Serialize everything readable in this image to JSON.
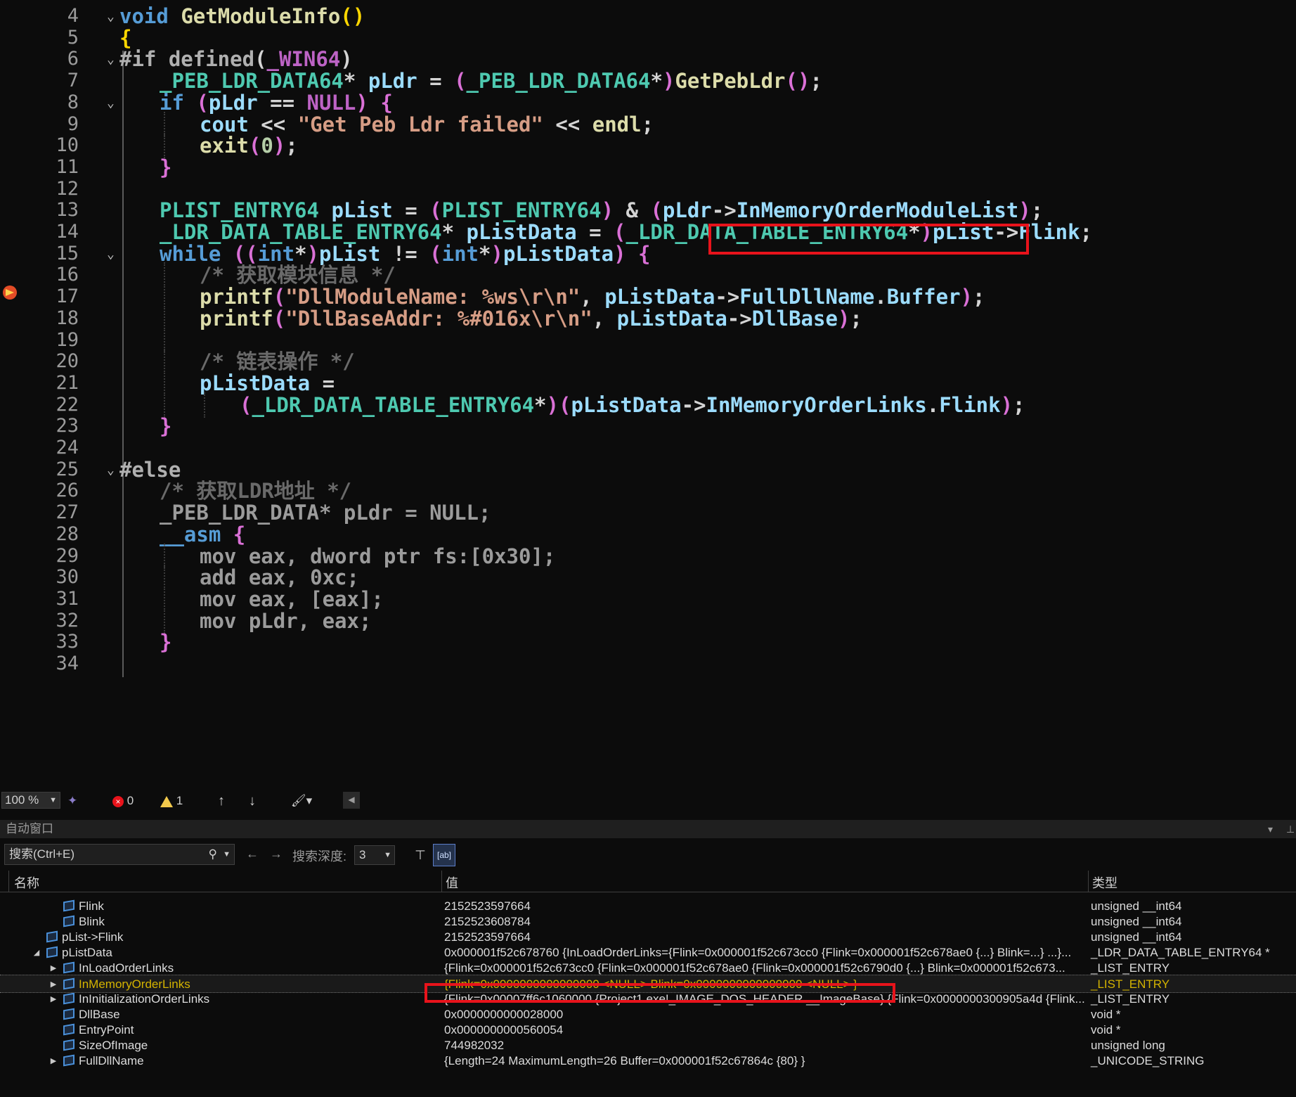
{
  "editor": {
    "lines": [
      {
        "n": "4",
        "i": 0,
        "fold": true,
        "segs": [
          [
            "void ",
            "kw"
          ],
          [
            "GetModuleInfo",
            "fn"
          ],
          [
            "()",
            "br2"
          ]
        ]
      },
      {
        "n": "5",
        "i": 0,
        "segs": [
          [
            "{",
            "br2"
          ]
        ]
      },
      {
        "n": "6",
        "i": 0,
        "fold": true,
        "segs": [
          [
            "#if ",
            "pp"
          ],
          [
            "defined",
            "pp"
          ],
          [
            "(",
            "pu"
          ],
          [
            "_WIN64",
            "mac"
          ],
          [
            ")",
            "pu"
          ]
        ]
      },
      {
        "n": "7",
        "i": 1,
        "segs": [
          [
            "_PEB_LDR_DATA64",
            "ty"
          ],
          [
            "* ",
            "pu"
          ],
          [
            "pLdr",
            "var"
          ],
          [
            " = ",
            "pu"
          ],
          [
            "(",
            "br"
          ],
          [
            "_PEB_LDR_DATA64",
            "ty"
          ],
          [
            "*",
            "pu"
          ],
          [
            ")",
            "br"
          ],
          [
            "GetPebLdr",
            "fn"
          ],
          [
            "()",
            "br"
          ],
          [
            ";",
            "pu"
          ]
        ]
      },
      {
        "n": "8",
        "i": 1,
        "fold": true,
        "segs": [
          [
            "if ",
            "kw"
          ],
          [
            "(",
            "br"
          ],
          [
            "pLdr",
            "var"
          ],
          [
            " == ",
            "pu"
          ],
          [
            "NULL",
            "mac"
          ],
          [
            ")",
            "br"
          ],
          [
            " {",
            "br"
          ]
        ]
      },
      {
        "n": "9",
        "i": 2,
        "segs": [
          [
            "cout",
            "var"
          ],
          [
            " << ",
            "pu"
          ],
          [
            "\"Get Peb Ldr failed\"",
            "st"
          ],
          [
            " << ",
            "pu"
          ],
          [
            "endl",
            "fn"
          ],
          [
            ";",
            "pu"
          ]
        ]
      },
      {
        "n": "10",
        "i": 2,
        "segs": [
          [
            "exit",
            "fn"
          ],
          [
            "(",
            "br"
          ],
          [
            "0",
            "num"
          ],
          [
            ")",
            "br"
          ],
          [
            ";",
            "pu"
          ]
        ]
      },
      {
        "n": "11",
        "i": 1,
        "segs": [
          [
            "}",
            "br"
          ]
        ]
      },
      {
        "n": "12",
        "i": 1,
        "segs": []
      },
      {
        "n": "13",
        "i": 1,
        "segs": [
          [
            "PLIST_ENTRY64",
            "ty"
          ],
          [
            " pList",
            "var"
          ],
          [
            " = ",
            "pu"
          ],
          [
            "(",
            "br"
          ],
          [
            "PLIST_ENTRY64",
            "ty"
          ],
          [
            ")",
            "br"
          ],
          [
            " & ",
            "pu"
          ],
          [
            "(",
            "br"
          ],
          [
            "pLdr",
            "var"
          ],
          [
            "->",
            "pu"
          ],
          [
            "InMemoryOrderModuleList",
            "var"
          ],
          [
            ")",
            "br"
          ],
          [
            ";",
            "pu"
          ]
        ]
      },
      {
        "n": "14",
        "i": 1,
        "segs": [
          [
            "_LDR_DATA_TABLE_ENTRY64",
            "ty"
          ],
          [
            "* ",
            "pu"
          ],
          [
            "pListData",
            "var"
          ],
          [
            " = ",
            "pu"
          ],
          [
            "(",
            "br"
          ],
          [
            "_LDR_DATA_TABLE_ENTRY64",
            "ty"
          ],
          [
            "*",
            "pu"
          ],
          [
            ")",
            "br"
          ],
          [
            "pList",
            "var"
          ],
          [
            "->",
            "pu"
          ],
          [
            "Flink",
            "var"
          ],
          [
            ";",
            "pu"
          ]
        ]
      },
      {
        "n": "15",
        "i": 1,
        "fold": true,
        "segs": [
          [
            "while ",
            "kw"
          ],
          [
            "((",
            "br"
          ],
          [
            "int",
            "kw"
          ],
          [
            "*",
            "pu"
          ],
          [
            ")",
            "br"
          ],
          [
            "pList",
            "var"
          ],
          [
            " != ",
            "pu"
          ],
          [
            "(",
            "br"
          ],
          [
            "int",
            "kw"
          ],
          [
            "*",
            "pu"
          ],
          [
            ")",
            "br"
          ],
          [
            "pListData",
            "var"
          ],
          [
            ")",
            "br"
          ],
          [
            " {",
            "br"
          ]
        ]
      },
      {
        "n": "16",
        "i": 2,
        "segs": [
          [
            "/* 获取模块信息 */",
            "cm"
          ]
        ]
      },
      {
        "n": "17",
        "i": 2,
        "segs": [
          [
            "printf",
            "fn"
          ],
          [
            "(",
            "br"
          ],
          [
            "\"DllModuleName: %ws\\r\\n\"",
            "st"
          ],
          [
            ", ",
            "pu"
          ],
          [
            "pListData",
            "var"
          ],
          [
            "->",
            "pu"
          ],
          [
            "FullDllName",
            "var"
          ],
          [
            ".",
            "pu"
          ],
          [
            "Buffer",
            "var"
          ],
          [
            ")",
            "br"
          ],
          [
            ";",
            "pu"
          ]
        ]
      },
      {
        "n": "18",
        "i": 2,
        "segs": [
          [
            "printf",
            "fn"
          ],
          [
            "(",
            "br"
          ],
          [
            "\"DllBaseAddr: %#016x\\r\\n\"",
            "st"
          ],
          [
            ", ",
            "pu"
          ],
          [
            "pListData",
            "var"
          ],
          [
            "->",
            "pu"
          ],
          [
            "DllBase",
            "var"
          ],
          [
            ")",
            "br"
          ],
          [
            ";",
            "pu"
          ]
        ]
      },
      {
        "n": "19",
        "i": 2,
        "segs": []
      },
      {
        "n": "20",
        "i": 2,
        "segs": [
          [
            "/* 链表操作 */",
            "cm"
          ]
        ]
      },
      {
        "n": "21",
        "i": 2,
        "segs": [
          [
            "pListData",
            "var"
          ],
          [
            " =",
            "pu"
          ]
        ]
      },
      {
        "n": "22",
        "i": 3,
        "segs": [
          [
            "(",
            "br"
          ],
          [
            "_LDR_DATA_TABLE_ENTRY64",
            "ty"
          ],
          [
            "*",
            "pu"
          ],
          [
            ")",
            "br"
          ],
          [
            "(",
            "br"
          ],
          [
            "pListData",
            "var"
          ],
          [
            "->",
            "pu"
          ],
          [
            "InMemoryOrderLinks",
            "var"
          ],
          [
            ".",
            "pu"
          ],
          [
            "Flink",
            "var"
          ],
          [
            ")",
            "br"
          ],
          [
            ";",
            "pu"
          ]
        ]
      },
      {
        "n": "23",
        "i": 1,
        "segs": [
          [
            "}",
            "br"
          ]
        ]
      },
      {
        "n": "24",
        "i": 1,
        "segs": []
      },
      {
        "n": "25",
        "i": 0,
        "fold": true,
        "segs": [
          [
            "#else",
            "pp"
          ]
        ]
      },
      {
        "n": "26",
        "i": 1,
        "segs": [
          [
            "/* 获取LDR地址 */",
            "cm"
          ]
        ]
      },
      {
        "n": "27",
        "i": 1,
        "segs": [
          [
            "_PEB_LDR_DATA",
            "gray"
          ],
          [
            "* ",
            "gray"
          ],
          [
            "pLdr",
            "gray"
          ],
          [
            " = ",
            "gray"
          ],
          [
            "NULL",
            "gray"
          ],
          [
            ";",
            "gray"
          ]
        ]
      },
      {
        "n": "28",
        "i": 1,
        "segs": [
          [
            "__asm",
            "kw"
          ],
          [
            " {",
            "br"
          ]
        ]
      },
      {
        "n": "29",
        "i": 2,
        "segs": [
          [
            "mov eax, dword ptr fs:[0x30];",
            "gray"
          ]
        ]
      },
      {
        "n": "30",
        "i": 2,
        "segs": [
          [
            "add eax, 0xc;",
            "gray"
          ]
        ]
      },
      {
        "n": "31",
        "i": 2,
        "segs": [
          [
            "mov eax, [eax];",
            "gray"
          ]
        ]
      },
      {
        "n": "32",
        "i": 2,
        "segs": [
          [
            "mov pLdr, eax;",
            "gray"
          ]
        ]
      },
      {
        "n": "33",
        "i": 1,
        "segs": [
          [
            "}",
            "br"
          ]
        ]
      },
      {
        "n": "34",
        "i": 1,
        "segs": []
      }
    ]
  },
  "status": {
    "zoom": "100 %",
    "errors": "0",
    "warnings": "1",
    "up_arrow": "↑",
    "down_arrow": "↓"
  },
  "autos": {
    "title": "自动窗口",
    "search_placeholder": "搜索(Ctrl+E)",
    "back": "←",
    "forward": "→",
    "depth_label": "搜索深度:",
    "depth_value": "3",
    "columns": {
      "name": "名称",
      "value": "值",
      "type": "类型"
    },
    "rows": [
      {
        "indent": 2,
        "exp": "",
        "name": "Flink",
        "value": "2152523597664",
        "type": "unsigned __int64"
      },
      {
        "indent": 2,
        "exp": "",
        "name": "Blink",
        "value": "2152523608784",
        "type": "unsigned __int64"
      },
      {
        "indent": 1,
        "exp": "",
        "name": "pList->Flink",
        "value": "2152523597664",
        "type": "unsigned __int64"
      },
      {
        "indent": 1,
        "exp": "◢",
        "name": "pListData",
        "value": "0x000001f52c678760 {InLoadOrderLinks={Flink=0x000001f52c673cc0 {Flink=0x000001f52c678ae0 {...} Blink=...} ...}...",
        "type": "_LDR_DATA_TABLE_ENTRY64 *"
      },
      {
        "indent": 2,
        "exp": "▶",
        "name": "InLoadOrderLinks",
        "value": "{Flink=0x000001f52c673cc0 {Flink=0x000001f52c678ae0 {Flink=0x000001f52c6790d0 {...} Blink=0x000001f52c673...",
        "type": "_LIST_ENTRY"
      },
      {
        "indent": 2,
        "exp": "▶",
        "name": "InMemoryOrderLinks",
        "value": "{Flink=0x0000000000000000 <NULL> Blink=0x0000000000000000 <NULL> }",
        "type": "_LIST_ENTRY",
        "changed": true,
        "selected": true
      },
      {
        "indent": 2,
        "exp": "▶",
        "name": "InInitializationOrderLinks",
        "value": "{Flink=0x00007ff6c1060000 {Project1.exe!_IMAGE_DOS_HEADER __ImageBase} {Flink=0x0000000300905a4d {Flink...",
        "type": "_LIST_ENTRY"
      },
      {
        "indent": 2,
        "exp": "",
        "name": "DllBase",
        "value": "0x0000000000028000",
        "type": "void *"
      },
      {
        "indent": 2,
        "exp": "",
        "name": "EntryPoint",
        "value": "0x0000000000560054",
        "type": "void *"
      },
      {
        "indent": 2,
        "exp": "",
        "name": "SizeOfImage",
        "value": "744982032",
        "type": "unsigned long"
      },
      {
        "indent": 2,
        "exp": "▶",
        "name": "FullDllName",
        "value": "{Length=24 MaximumLength=26 Buffer=0x000001f52c67864c {80} }",
        "type": "_UNICODE_STRING"
      }
    ]
  }
}
